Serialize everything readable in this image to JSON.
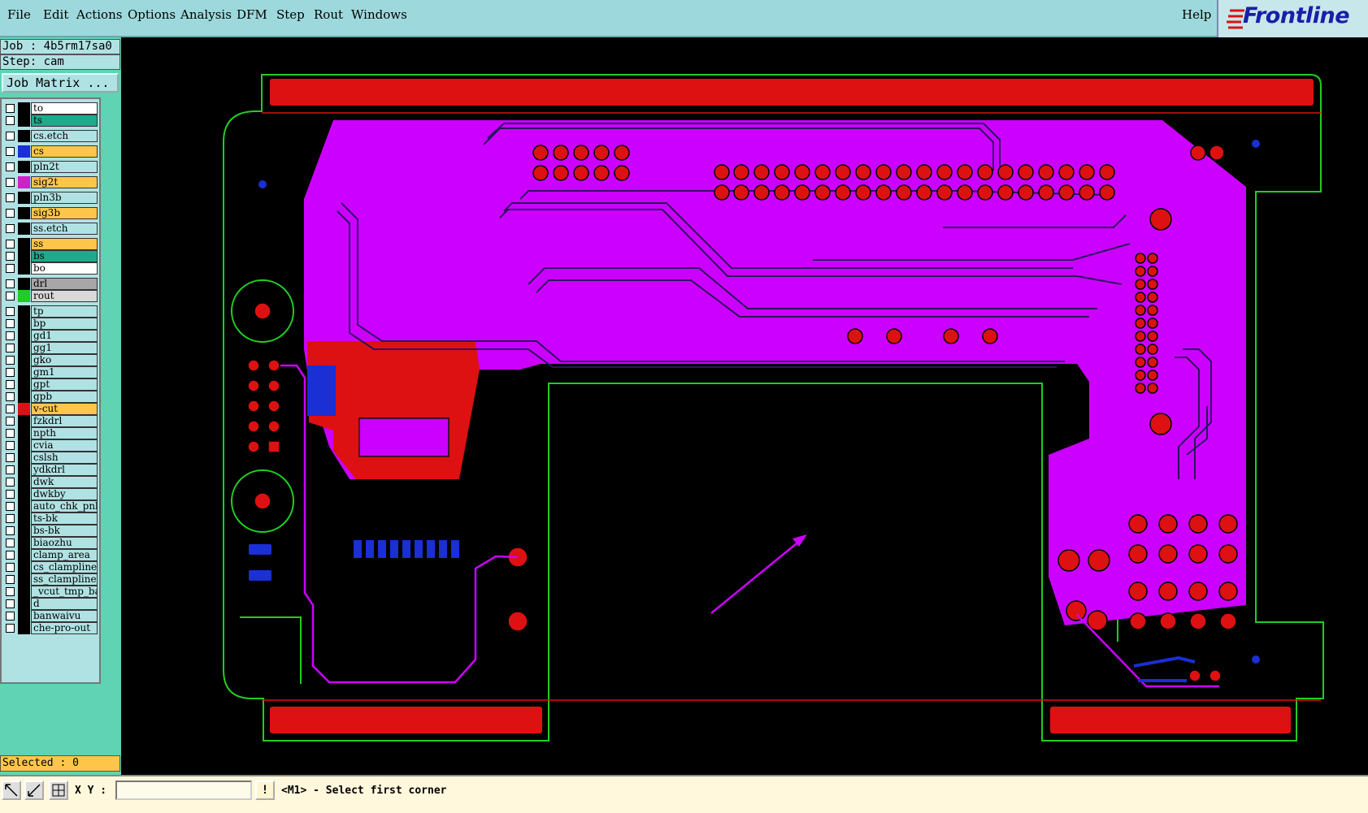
{
  "menu": {
    "items": [
      "File",
      "Edit",
      "Actions",
      "Options",
      "Analysis",
      "DFM",
      "Step",
      "Rout",
      "Windows"
    ],
    "help": "Help"
  },
  "logo": {
    "text": "Frontline",
    "color": "#1a1ea8"
  },
  "sidebar": {
    "job": "Job : 4b5rm17sa0",
    "step": "Step: cam",
    "job_matrix": "Job Matrix ...",
    "selected": "Selected : 0"
  },
  "layers": [
    {
      "name": "to",
      "color": "#000000",
      "bg": "#ffffff",
      "gap": false
    },
    {
      "name": "ts",
      "color": "#000000",
      "bg": "#1faa8c",
      "gap": false
    },
    {
      "name": "cs.etch",
      "color": "#000000",
      "bg": "#b0e2e4",
      "gap": true
    },
    {
      "name": "cs",
      "color": "#1a2fd4",
      "bg": "#fdc64b",
      "gap": true
    },
    {
      "name": "pln2t",
      "color": "#000000",
      "bg": "#b0e2e4",
      "gap": true
    },
    {
      "name": "sig2t",
      "color": "#cc22cc",
      "bg": "#fdc64b",
      "gap": true
    },
    {
      "name": "pln3b",
      "color": "#000000",
      "bg": "#b0e2e4",
      "gap": true
    },
    {
      "name": "sig3b",
      "color": "#000000",
      "bg": "#fdc64b",
      "gap": true
    },
    {
      "name": "ss.etch",
      "color": "#000000",
      "bg": "#b0e2e4",
      "gap": true
    },
    {
      "name": "ss",
      "color": "#000000",
      "bg": "#fdc64b",
      "gap": true
    },
    {
      "name": "bs",
      "color": "#000000",
      "bg": "#1faa8c",
      "gap": false
    },
    {
      "name": "bo",
      "color": "#000000",
      "bg": "#ffffff",
      "gap": false
    },
    {
      "name": "drl",
      "color": "#000000",
      "bg": "#a7a7a7",
      "gap": true
    },
    {
      "name": "rout",
      "color": "#22cc22",
      "bg": "#d9d9d9",
      "gap": false
    },
    {
      "name": "tp",
      "color": "#000000",
      "bg": "#b0e2e4",
      "gap": true
    },
    {
      "name": "bp",
      "color": "#000000",
      "bg": "#b0e2e4",
      "gap": false
    },
    {
      "name": "gd1",
      "color": "#000000",
      "bg": "#b0e2e4",
      "gap": false
    },
    {
      "name": "gg1",
      "color": "#000000",
      "bg": "#b0e2e4",
      "gap": false
    },
    {
      "name": "gko",
      "color": "#000000",
      "bg": "#b0e2e4",
      "gap": false
    },
    {
      "name": "gm1",
      "color": "#000000",
      "bg": "#b0e2e4",
      "gap": false
    },
    {
      "name": "gpt",
      "color": "#000000",
      "bg": "#b0e2e4",
      "gap": false
    },
    {
      "name": "gpb",
      "color": "#000000",
      "bg": "#b0e2e4",
      "gap": false
    },
    {
      "name": "v-cut",
      "color": "#dd1111",
      "bg": "#fdc64b",
      "gap": false
    },
    {
      "name": "fzkdrl",
      "color": "#000000",
      "bg": "#b0e2e4",
      "gap": false
    },
    {
      "name": "npth",
      "color": "#000000",
      "bg": "#b0e2e4",
      "gap": false
    },
    {
      "name": "cvia",
      "color": "#000000",
      "bg": "#b0e2e4",
      "gap": false
    },
    {
      "name": "cslsh",
      "color": "#000000",
      "bg": "#b0e2e4",
      "gap": false
    },
    {
      "name": "ydkdrl",
      "color": "#000000",
      "bg": "#b0e2e4",
      "gap": false
    },
    {
      "name": "dwk",
      "color": "#000000",
      "bg": "#b0e2e4",
      "gap": false
    },
    {
      "name": "dwkby",
      "color": "#000000",
      "bg": "#b0e2e4",
      "gap": false
    },
    {
      "name": "auto_chk_pnl",
      "color": "#000000",
      "bg": "#b0e2e4",
      "gap": false
    },
    {
      "name": "ts-bk",
      "color": "#000000",
      "bg": "#b0e2e4",
      "gap": false
    },
    {
      "name": "bs-bk",
      "color": "#000000",
      "bg": "#b0e2e4",
      "gap": false
    },
    {
      "name": "biaozhu",
      "color": "#000000",
      "bg": "#b0e2e4",
      "gap": false
    },
    {
      "name": "clamp_area",
      "color": "#000000",
      "bg": "#b0e2e4",
      "gap": false
    },
    {
      "name": "cs_clampline",
      "color": "#000000",
      "bg": "#b0e2e4",
      "gap": false
    },
    {
      "name": "ss_clampline",
      "color": "#000000",
      "bg": "#b0e2e4",
      "gap": false
    },
    {
      "name": "_vcut_tmp_bak",
      "color": "#000000",
      "bg": "#b0e2e4",
      "gap": false
    },
    {
      "name": "d",
      "color": "#000000",
      "bg": "#b0e2e4",
      "gap": false
    },
    {
      "name": "banwaivu",
      "color": "#000000",
      "bg": "#b0e2e4",
      "gap": false
    },
    {
      "name": "che-pro-out",
      "color": "#000000",
      "bg": "#b0e2e4",
      "gap": false
    }
  ],
  "statusbar": {
    "xy_label": "X Y :",
    "xy_value": "",
    "warn": "!",
    "prompt": "<M1> - Select first corner"
  },
  "colors": {
    "background": "#000000",
    "copper_top": "#dd1111",
    "signal_layer": "#cc00ff",
    "bottom_layer": "#1a2fd4",
    "outline": "#22cc22"
  }
}
